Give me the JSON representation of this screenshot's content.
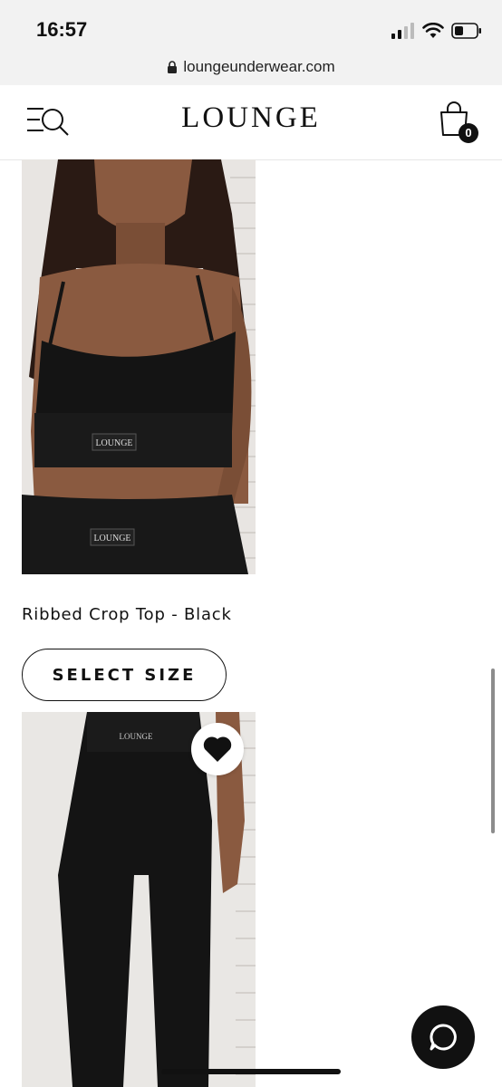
{
  "status_bar": {
    "time": "16:57"
  },
  "browser": {
    "url": "loungeunderwear.com"
  },
  "header": {
    "brand": "LOUNGE",
    "cart_count": "0",
    "menu_icon": "menu-search-icon",
    "cart_icon": "shopping-bag-icon"
  },
  "products": [
    {
      "name": "Ribbed Crop Top - Black",
      "image_label": "LOUNGE",
      "image_label_2": "LOUNGE",
      "action": "SELECT SIZE"
    },
    {
      "image_label": "LOUNGE",
      "wishlist_icon": "heart-icon"
    }
  ],
  "chat": {
    "icon": "chat-bubble-icon"
  },
  "colors": {
    "accent": "#111111",
    "status_bar_bg": "#f2f2f2",
    "background": "#ffffff"
  }
}
